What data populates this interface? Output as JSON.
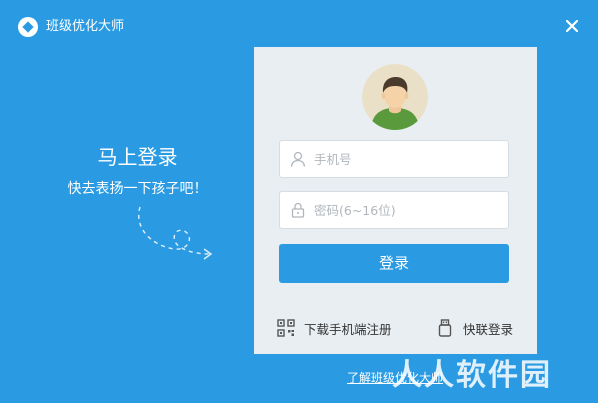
{
  "window": {
    "title": "班级优化大师",
    "close_label": "×"
  },
  "promo": {
    "title": "马上登录",
    "subtitle": "快去表扬一下孩子吧！"
  },
  "login": {
    "phone_placeholder": "手机号",
    "password_placeholder": "密码(6~16位)",
    "submit_label": "登录",
    "download_label": "下载手机端注册",
    "quick_login_label": "快联登录"
  },
  "footer": {
    "about_label": "了解班级优化大师"
  },
  "watermark": {
    "text": "人人软件园"
  },
  "colors": {
    "primary": "#2a9be3",
    "panel": "#e9eef2",
    "avatar_bg": "#eae0c8",
    "shirt": "#5a9a3c"
  }
}
